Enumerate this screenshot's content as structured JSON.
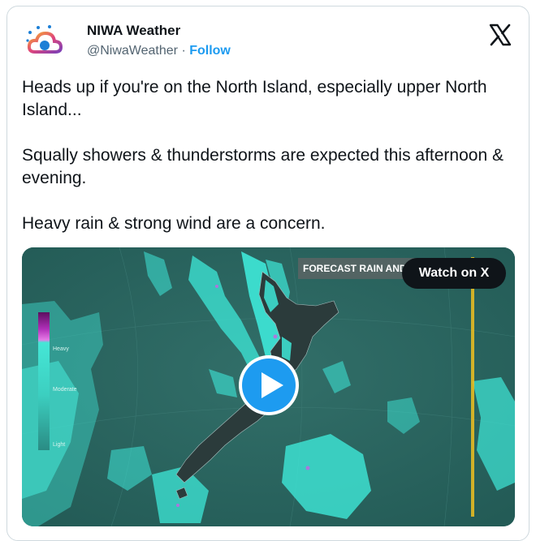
{
  "account": {
    "display_name": "NIWA Weather",
    "handle": "@NiwaWeather",
    "separator": "·",
    "follow_label": "Follow"
  },
  "icons": {
    "avatar": "niwa-logo-icon",
    "platform": "x-logo-icon",
    "play": "play-icon"
  },
  "tweet": {
    "paragraphs": [
      "Heads up if you're on the North Island, especially upper North Island...",
      "Squally showers & thunderstorms are expected this afternoon & evening.",
      "Heavy rain & strong wind are a concern."
    ]
  },
  "media": {
    "overlay_title": "FORECAST RAIN AND",
    "watch_label": "Watch on X",
    "legend": {
      "heavy": "Heavy",
      "moderate": "Moderate",
      "light": "Light"
    }
  },
  "colors": {
    "follow": "#1d9bf0",
    "rain": "#3ee8d8",
    "map_bg": "#2c6a64",
    "play": "#1d9bf0"
  }
}
